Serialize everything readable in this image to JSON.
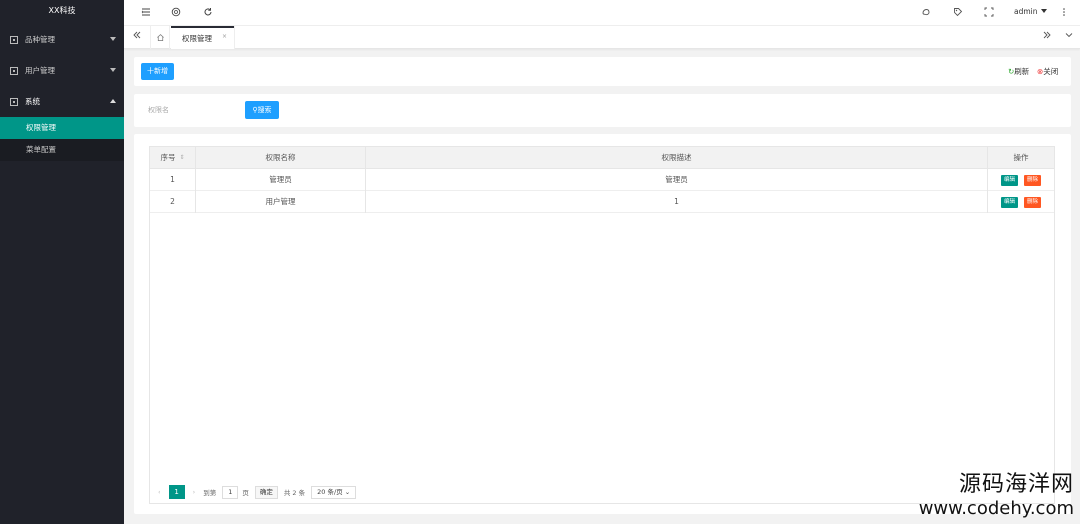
{
  "sidebar": {
    "logo": "XX科技",
    "menus": [
      {
        "label": "品种管理"
      },
      {
        "label": "用户管理"
      },
      {
        "label": "系统"
      }
    ],
    "submenu": [
      {
        "label": "权限管理"
      },
      {
        "label": "菜单配置"
      }
    ]
  },
  "header": {
    "user": "admin",
    "icons": [
      "menu-fold-icon",
      "globe-icon",
      "refresh-icon",
      "theme-icon",
      "tag-icon",
      "fullscreen-icon",
      "more-icon"
    ]
  },
  "tabs": {
    "active_label": "权限管理",
    "close": "×"
  },
  "toolbar": {
    "add_label": "十新增",
    "refresh_label": "刷新",
    "close_label": "关闭"
  },
  "search": {
    "placeholder": "权限名",
    "button_label": "搜索"
  },
  "table": {
    "headers": [
      "序号",
      "权限名称",
      "权限描述",
      "操作"
    ],
    "rows": [
      {
        "index": "1",
        "name": "管理员",
        "desc": "管理员",
        "edit": "编辑",
        "del": "删除"
      },
      {
        "index": "2",
        "name": "用户管理",
        "desc": "1",
        "edit": "编辑",
        "del": "删除"
      }
    ]
  },
  "pager": {
    "current": "1",
    "goto_label": "到第",
    "goto_value": "1",
    "page_unit": "页",
    "confirm_label": "确定",
    "total_label": "共 2 条",
    "size_label": "20 条/页"
  },
  "watermark": {
    "line1": "源码海洋网",
    "line2": "www.codehy.com"
  }
}
